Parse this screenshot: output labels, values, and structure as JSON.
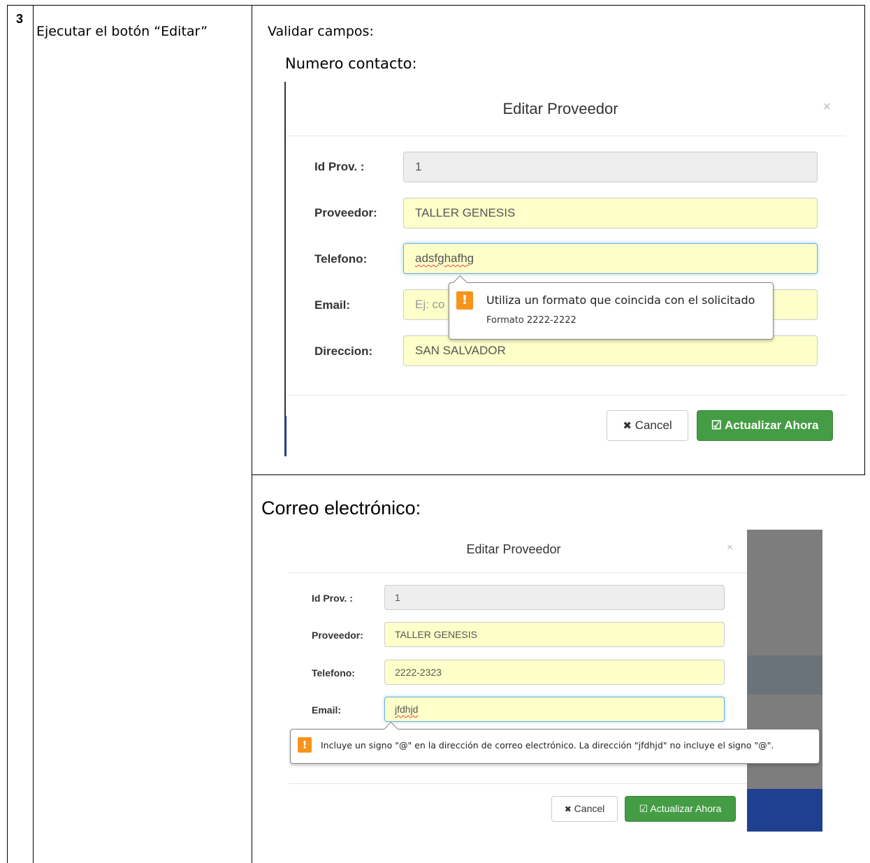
{
  "step": {
    "number": "3",
    "action": "Ejecutar el botón “Editar”",
    "heading": "Validar campos:"
  },
  "section1": {
    "caption": "Numero contacto:",
    "modal": {
      "title": "Editar Proveedor",
      "close": "×",
      "fields": {
        "id": {
          "label": "Id Prov. :",
          "value": "1"
        },
        "proveedor": {
          "label": "Proveedor:",
          "value": "TALLER GENESIS"
        },
        "telefono": {
          "label": "Telefono:",
          "value": "adsfghafhg"
        },
        "email": {
          "label": "Email:",
          "placeholder": "Ej: co"
        },
        "direccion": {
          "label": "Direccion:",
          "value": "SAN SALVADOR"
        }
      },
      "tooltip": {
        "icon": "!",
        "message": "Utiliza un formato que coincida con el solicitado",
        "hint": "Formato 2222-2222"
      },
      "cancel_icon": "✖",
      "cancel_label": "Cancel",
      "update_icon": "☑",
      "update_label": "Actualizar Ahora"
    }
  },
  "section2": {
    "caption": "Correo electrónico:",
    "modal": {
      "title": "Editar Proveedor",
      "close": "×",
      "fields": {
        "id": {
          "label": "Id Prov. :",
          "value": "1"
        },
        "proveedor": {
          "label": "Proveedor:",
          "value": "TALLER GENESIS"
        },
        "telefono": {
          "label": "Telefono:",
          "value": "2222-2323"
        },
        "email": {
          "label": "Email:",
          "value": "jfdhjd"
        }
      },
      "tooltip": {
        "icon": "!",
        "message": "Incluye un signo \"@\" en la dirección de correo electrónico. La dirección \"jfdhjd\" no incluye el signo \"@\"."
      },
      "cancel_icon": "✖",
      "cancel_label": "Cancel",
      "update_icon": "☑",
      "update_label": "Actualizar Ahora"
    }
  },
  "colors": {
    "input_bg": "#ffffc9",
    "readonly_bg": "#eeeeee",
    "success": "#449d44",
    "warning": "#f7941d",
    "focus": "#66afe9"
  }
}
